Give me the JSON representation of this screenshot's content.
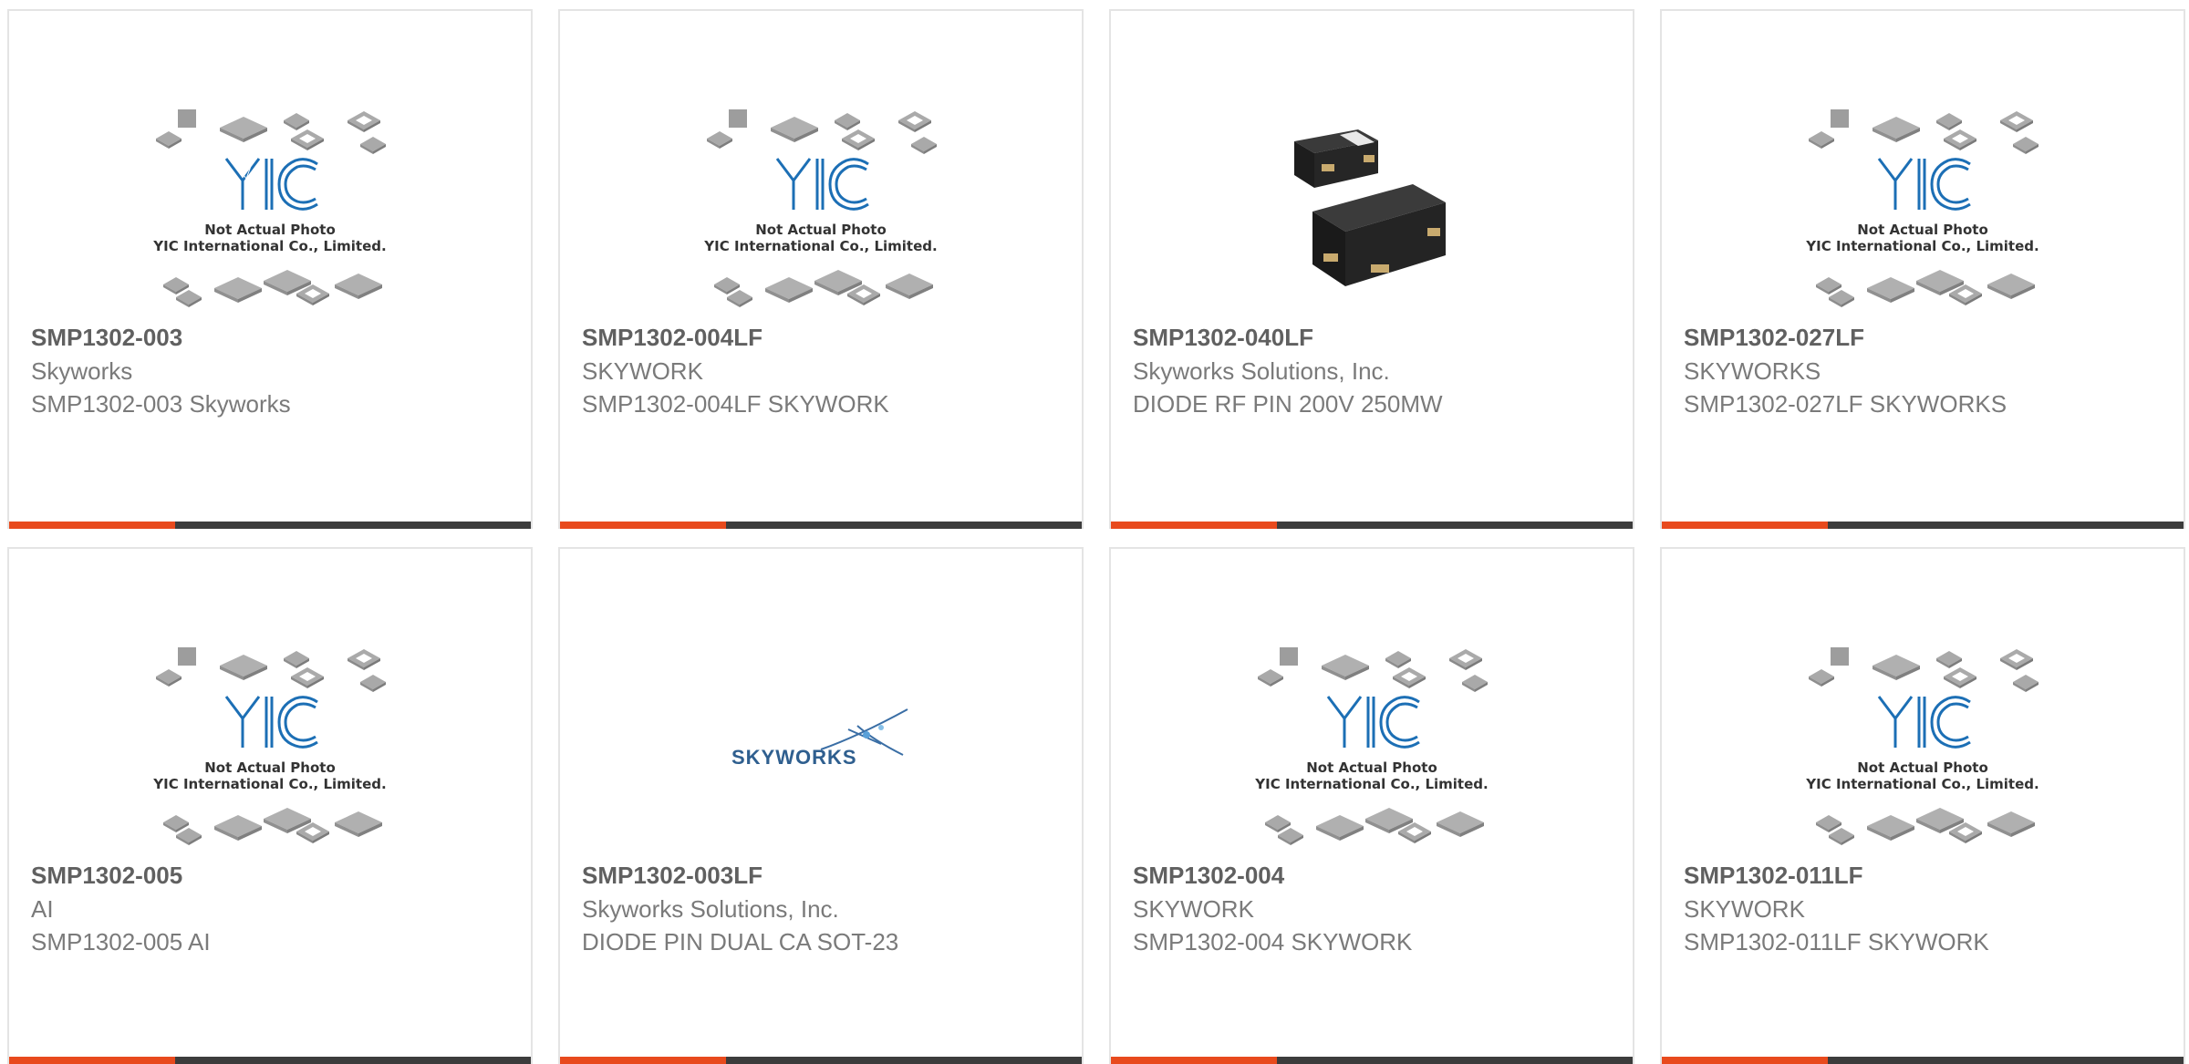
{
  "placeholder_image": {
    "line1": "Not Actual Photo",
    "line2": "YIC International Co., Limited.",
    "brand": "YIC"
  },
  "colors": {
    "accent_bar": "#e84a1d",
    "dark_bar": "#3c3c3c",
    "part_text": "#606060",
    "secondary_text": "#7a7a7a",
    "yic_blue": "#1c6fb5"
  },
  "products": [
    {
      "part": "SMP1302-003",
      "manufacturer": "Skyworks",
      "description": "SMP1302-003 Skyworks",
      "image": "placeholder"
    },
    {
      "part": "SMP1302-004LF",
      "manufacturer": "SKYWORK",
      "description": "SMP1302-004LF SKYWORK",
      "image": "placeholder"
    },
    {
      "part": "SMP1302-040LF",
      "manufacturer": "Skyworks Solutions, Inc.",
      "description": "DIODE RF PIN 200V 250MW",
      "image": "diode-chip-photo"
    },
    {
      "part": "SMP1302-027LF",
      "manufacturer": "SKYWORKS",
      "description": "SMP1302-027LF SKYWORKS",
      "image": "placeholder"
    },
    {
      "part": "SMP1302-005",
      "manufacturer": "AI",
      "description": "SMP1302-005 AI",
      "image": "placeholder"
    },
    {
      "part": "SMP1302-003LF",
      "manufacturer": "Skyworks Solutions, Inc.",
      "description": "DIODE PIN DUAL CA SOT-23",
      "image": "skyworks-logo",
      "logo_text": "SKYWORKS"
    },
    {
      "part": "SMP1302-004",
      "manufacturer": "SKYWORK",
      "description": "SMP1302-004 SKYWORK",
      "image": "placeholder"
    },
    {
      "part": "SMP1302-011LF",
      "manufacturer": "SKYWORK",
      "description": "SMP1302-011LF SKYWORK",
      "image": "placeholder"
    }
  ]
}
